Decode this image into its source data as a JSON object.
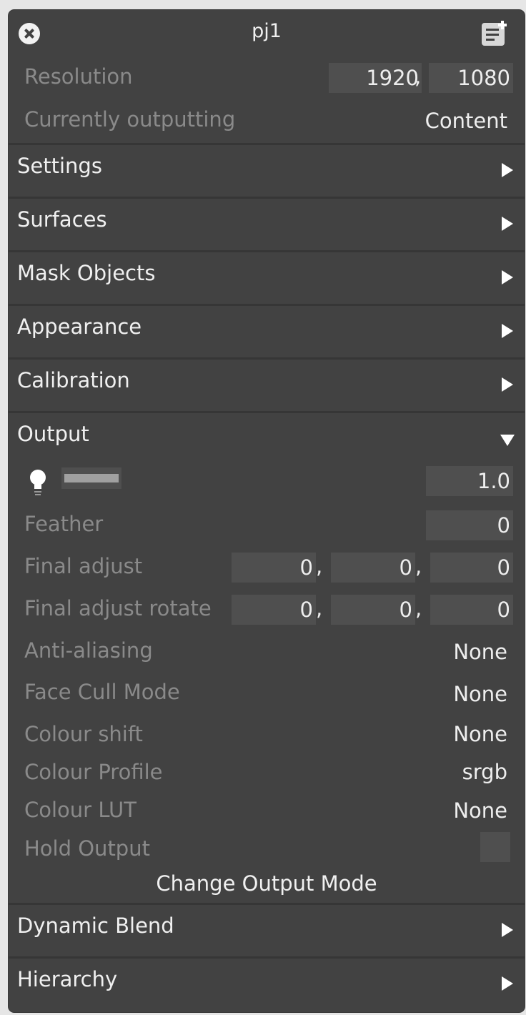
{
  "window": {
    "title": "pj1",
    "close_icon": "close-circle-icon",
    "note_icon": "edit-note-icon"
  },
  "resolution": {
    "label": "Resolution",
    "width": "1920",
    "height": "1080",
    "sep": ","
  },
  "currently_outputting": {
    "label": "Currently outputting",
    "value": "Content"
  },
  "sections": {
    "settings": "Settings",
    "surfaces": "Surfaces",
    "mask_objects": "Mask Objects",
    "appearance": "Appearance",
    "calibration": "Calibration",
    "output": "Output",
    "dynamic_blend": "Dynamic Blend",
    "hierarchy": "Hierarchy"
  },
  "output": {
    "brightness": {
      "icon": "light-bulb-icon",
      "value": "1.0"
    },
    "feather": {
      "label": "Feather",
      "value": "0"
    },
    "final_adjust": {
      "label": "Final adjust",
      "values": [
        "0",
        "0",
        "0"
      ],
      "sep": ","
    },
    "final_adjust_rotate": {
      "label": "Final adjust rotate",
      "values": [
        "0",
        "0",
        "0"
      ],
      "sep": ","
    },
    "anti_aliasing": {
      "label": "Anti-aliasing",
      "value": "None"
    },
    "face_cull_mode": {
      "label": "Face Cull Mode",
      "value": "None"
    },
    "colour_shift": {
      "label": "Colour shift",
      "value": "None"
    },
    "colour_profile": {
      "label": "Colour Profile",
      "value": "srgb"
    },
    "colour_lut": {
      "label": "Colour LUT",
      "value": "None"
    },
    "hold_output": {
      "label": "Hold Output",
      "checked": false
    },
    "change_mode_label": "Change Output Mode"
  },
  "colors": {
    "panel": "#424242",
    "field": "#4f4f4f",
    "label_dim": "#8a8a8a",
    "text": "#f0f0f0"
  }
}
